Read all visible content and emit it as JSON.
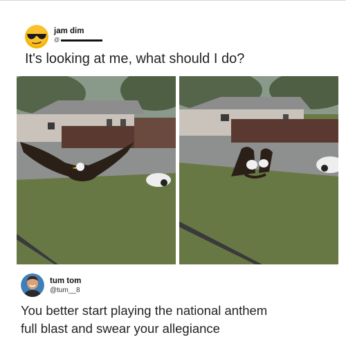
{
  "post": {
    "author_name": "jam dim",
    "author_handle": "@",
    "text": "It's looking at me, what should I do?",
    "avatar_icon": "sunglasses-emoji-icon"
  },
  "photos": [
    {
      "subject": "bald-eagle-wings-spread"
    },
    {
      "subject": "bald-eagles-on-lawn"
    }
  ],
  "reply": {
    "author_name": "tum tom",
    "author_handle": "@tum__8",
    "text_line_1": "You better start playing the national anthem",
    "text_line_2": "full blast and swear your allegiance",
    "avatar_icon": "profile-photo-icon"
  },
  "colors": {
    "grass": "#6b7a45",
    "road": "#8e9090",
    "house": "#c9c3bb",
    "fence": "#5a3a30",
    "emoji_yellow": "#f4b400"
  }
}
